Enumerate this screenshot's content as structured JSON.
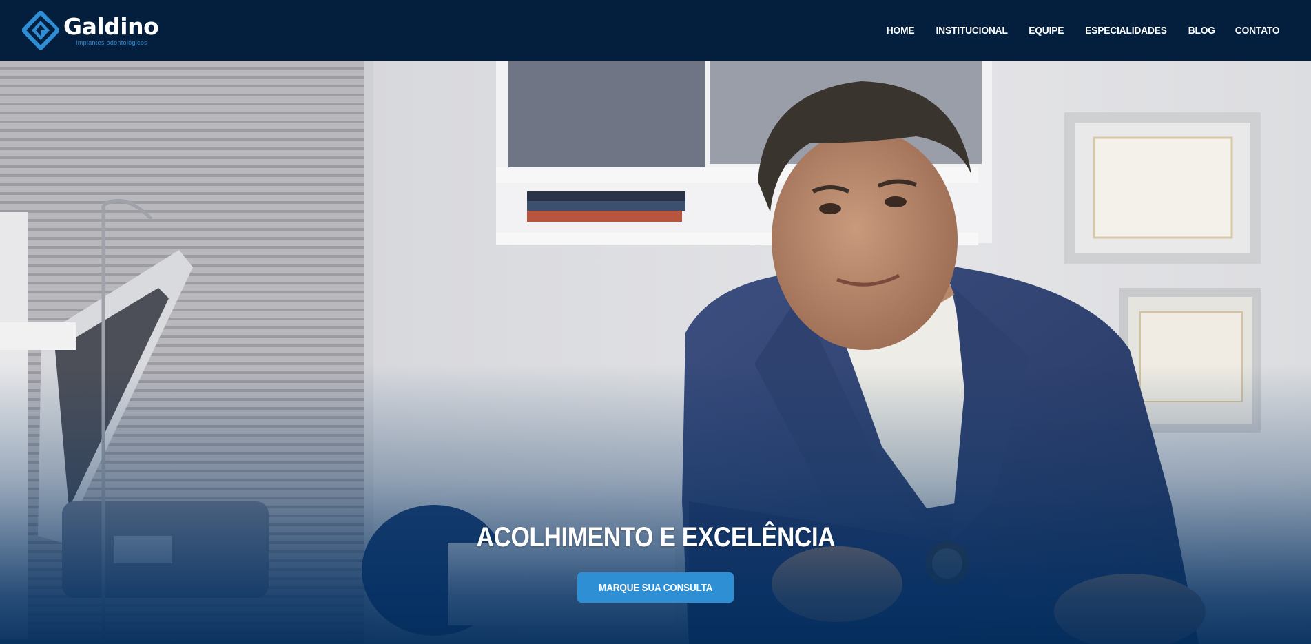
{
  "brand": {
    "name": "Galdino",
    "tagline": "Implantes odontológicos",
    "logo_icon": "diamond-g-logo-icon",
    "colors": {
      "navy": "#041e3d",
      "accent": "#2e8fd4",
      "logo_blue": "#2d8ed6"
    }
  },
  "nav": {
    "items": [
      {
        "label": "HOME"
      },
      {
        "label": "INSTITUCIONAL"
      },
      {
        "label": "EQUIPE"
      },
      {
        "label": "ESPECIALIDADES"
      },
      {
        "label": "BLOG"
      },
      {
        "label": "CONTATO"
      }
    ]
  },
  "hero": {
    "title": "ACOLHIMENTO E EXCELÊNCIA",
    "cta_label": "MARQUE SUA CONSULTA",
    "image_subject": "dentist-portrait-photo"
  }
}
